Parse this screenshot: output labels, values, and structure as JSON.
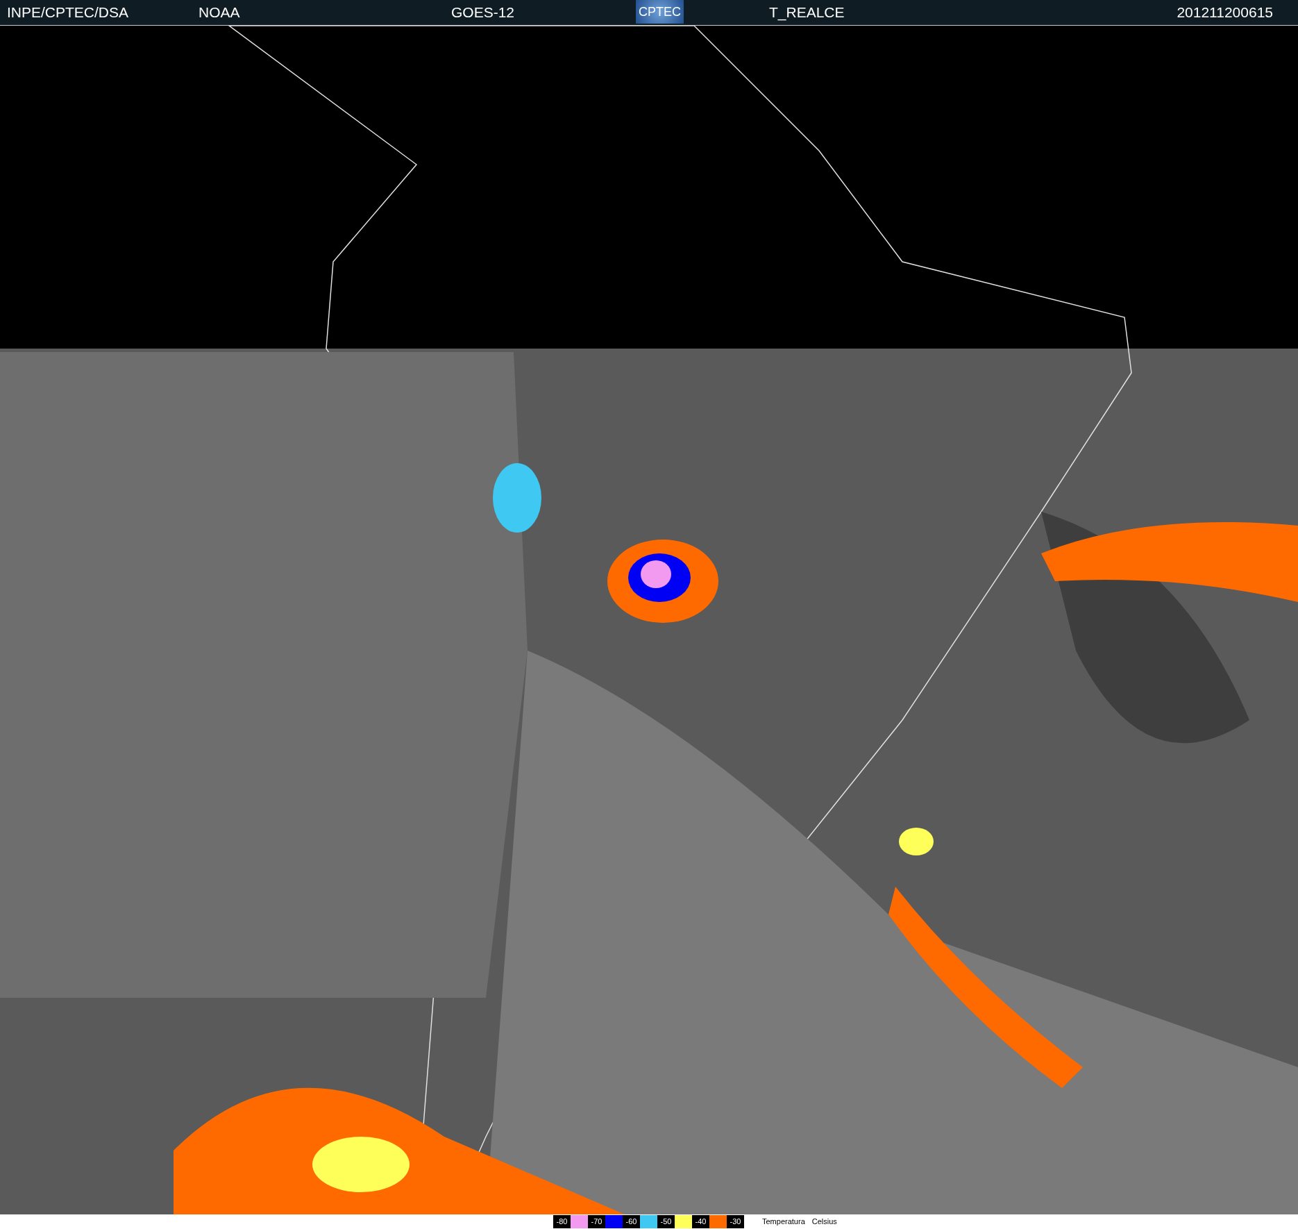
{
  "header": {
    "source": "INPE/CPTEC/DSA",
    "agency": "NOAA",
    "satellite": "GOES-12",
    "logo": "CPTEC",
    "product": "T_REALCE",
    "timestamp": "201211200615"
  },
  "legend": {
    "steps": [
      {
        "label": "-80",
        "color": "#f29af0"
      },
      {
        "label": "-70",
        "color": "#0000f5"
      },
      {
        "label": "-60",
        "color": "#3fc8f2"
      },
      {
        "label": "-50",
        "color": "#ffff5a"
      },
      {
        "label": "-40",
        "color": "#ff6a00"
      },
      {
        "label": "-30"
      }
    ],
    "title": "Temperatura",
    "unit": "Celsius"
  }
}
